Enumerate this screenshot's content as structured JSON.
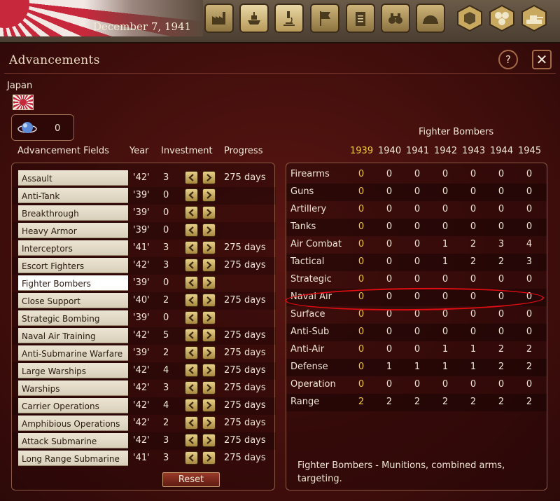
{
  "topbar": {
    "date": "December 7, 1941",
    "buttons": [
      {
        "name": "production",
        "icon": "factory-icon"
      },
      {
        "name": "ships",
        "icon": "ship-icon",
        "active": true
      },
      {
        "name": "research",
        "icon": "microscope-icon",
        "active": true
      },
      {
        "name": "diplomacy",
        "icon": "flag-icon"
      },
      {
        "name": "orders",
        "icon": "clipboard-icon"
      },
      {
        "name": "intelligence",
        "icon": "binoculars-icon"
      },
      {
        "name": "army",
        "icon": "helmet-icon"
      }
    ],
    "hex_buttons": [
      "hex-icon",
      "hex-cluster-icon",
      "tank-icon"
    ]
  },
  "dialog": {
    "title": "Advancements",
    "help_label": "?",
    "close_label": "✕",
    "nation": "Japan",
    "research_points": "0",
    "headers": {
      "fields": "Advancement Fields",
      "year": "Year",
      "investment": "Investment",
      "progress": "Progress"
    },
    "fields": [
      {
        "name": "Assault",
        "year": "'42'",
        "investment": "3",
        "progress": "275 days"
      },
      {
        "name": "Anti-Tank",
        "year": "'39'",
        "investment": "0",
        "progress": ""
      },
      {
        "name": "Breakthrough",
        "year": "'39'",
        "investment": "0",
        "progress": ""
      },
      {
        "name": "Heavy Armor",
        "year": "'39'",
        "investment": "0",
        "progress": ""
      },
      {
        "name": "Interceptors",
        "year": "'41'",
        "investment": "3",
        "progress": "275 days"
      },
      {
        "name": "Escort Fighters",
        "year": "'42'",
        "investment": "3",
        "progress": "275 days"
      },
      {
        "name": "Fighter Bombers",
        "year": "'39'",
        "investment": "0",
        "progress": "",
        "selected": true
      },
      {
        "name": "Close Support",
        "year": "'40'",
        "investment": "2",
        "progress": "275 days"
      },
      {
        "name": "Strategic Bombing",
        "year": "'39'",
        "investment": "0",
        "progress": ""
      },
      {
        "name": "Naval Air Training",
        "year": "'42'",
        "investment": "5",
        "progress": "275 days"
      },
      {
        "name": "Anti-Submarine Warfare",
        "year": "'39'",
        "investment": "2",
        "progress": "275 days"
      },
      {
        "name": "Large Warships",
        "year": "'42'",
        "investment": "4",
        "progress": "275 days"
      },
      {
        "name": "Warships",
        "year": "'42'",
        "investment": "3",
        "progress": "275 days"
      },
      {
        "name": "Carrier Operations",
        "year": "'42'",
        "investment": "4",
        "progress": "275 days"
      },
      {
        "name": "Amphibious Operations",
        "year": "'42'",
        "investment": "2",
        "progress": "275 days"
      },
      {
        "name": "Attack Submarine",
        "year": "'42'",
        "investment": "3",
        "progress": "275 days"
      },
      {
        "name": "Long Range Submarine",
        "year": "'41'",
        "investment": "3",
        "progress": "275 days"
      }
    ],
    "reset_label": "Reset",
    "matrix": {
      "title": "Fighter Bombers",
      "years": [
        "1939",
        "1940",
        "1941",
        "1942",
        "1943",
        "1944",
        "1945"
      ],
      "current_year": "1939",
      "rows": [
        {
          "name": "Firearms",
          "values": [
            "0",
            "0",
            "0",
            "0",
            "0",
            "0",
            "0"
          ]
        },
        {
          "name": "Guns",
          "values": [
            "0",
            "0",
            "0",
            "0",
            "0",
            "0",
            "0"
          ]
        },
        {
          "name": "Artillery",
          "values": [
            "0",
            "0",
            "0",
            "0",
            "0",
            "0",
            "0"
          ]
        },
        {
          "name": "Tanks",
          "values": [
            "0",
            "0",
            "0",
            "0",
            "0",
            "0",
            "0"
          ]
        },
        {
          "name": "Air Combat",
          "values": [
            "0",
            "0",
            "0",
            "1",
            "2",
            "3",
            "4"
          ]
        },
        {
          "name": "Tactical",
          "values": [
            "0",
            "0",
            "0",
            "1",
            "2",
            "2",
            "3"
          ]
        },
        {
          "name": "Strategic",
          "values": [
            "0",
            "0",
            "0",
            "0",
            "0",
            "0",
            "0"
          ]
        },
        {
          "name": "Naval Air",
          "values": [
            "0",
            "0",
            "0",
            "0",
            "0",
            "0",
            "0"
          ],
          "highlighted": true
        },
        {
          "name": "Surface",
          "values": [
            "0",
            "0",
            "0",
            "0",
            "0",
            "0",
            "0"
          ]
        },
        {
          "name": "Anti-Sub",
          "values": [
            "0",
            "0",
            "0",
            "0",
            "0",
            "0",
            "0"
          ]
        },
        {
          "name": "Anti-Air",
          "values": [
            "0",
            "0",
            "0",
            "1",
            "1",
            "2",
            "2"
          ]
        },
        {
          "name": "Defense",
          "values": [
            "0",
            "1",
            "1",
            "1",
            "1",
            "2",
            "2"
          ]
        },
        {
          "name": "Operation",
          "values": [
            "0",
            "0",
            "0",
            "0",
            "0",
            "0",
            "0"
          ]
        },
        {
          "name": "Range",
          "values": [
            "2",
            "2",
            "2",
            "2",
            "2",
            "2",
            "2"
          ]
        }
      ],
      "description": "Fighter Bombers - Munitions, combined arms, targeting."
    }
  },
  "colors": {
    "highlight_circle": "#e00d12",
    "current_year": "#f2c93a",
    "panel_bg": "#3d0d0b"
  }
}
